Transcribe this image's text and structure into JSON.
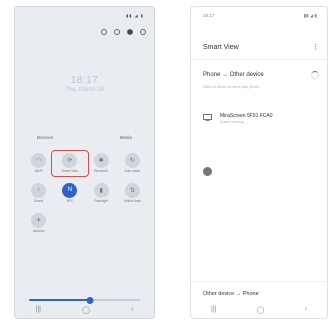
{
  "quick_panel": {
    "time": "18:17",
    "date": "Thu, March 19",
    "devices_label": "Devices",
    "media_label": "Media",
    "tiles": [
      {
        "label": "Wi-Fi",
        "icon": "wifi-icon",
        "glyph": "◠",
        "on": false
      },
      {
        "label": "Smart View",
        "icon": "smart-view-icon",
        "glyph": "⟳",
        "on": false,
        "highlighted": true
      },
      {
        "label": "Bluetooth",
        "icon": "bluetooth-icon",
        "glyph": "✱",
        "on": false
      },
      {
        "label": "Auto rotate",
        "icon": "rotate-icon",
        "glyph": "↻",
        "on": false
      },
      {
        "label": "Sound",
        "icon": "sound-icon",
        "glyph": "♪",
        "on": false
      },
      {
        "label": "NFC",
        "icon": "nfc-icon",
        "glyph": "N",
        "on": true
      },
      {
        "label": "Flashlight",
        "icon": "flashlight-icon",
        "glyph": "▮",
        "on": false
      },
      {
        "label": "Mobile data",
        "icon": "mobile-data-icon",
        "glyph": "⇅",
        "on": false
      },
      {
        "label": "Airplane",
        "icon": "airplane-icon",
        "glyph": "✈",
        "on": false
      }
    ],
    "brightness": 0.55,
    "nav": [
      "|||",
      "◯",
      "‹"
    ]
  },
  "smart_view": {
    "status_time": "18:17",
    "status_right": "▮▮ ◢ ▮",
    "title": "Smart View",
    "more": "⋮",
    "section_title": "Phone → Other device",
    "description": "Select a device to mirror your phone.",
    "device": {
      "name": "MiraScreen 5F91 FCA0",
      "sub": "Screen mirroring"
    },
    "footer": "Other device → Phone",
    "nav": [
      "|||",
      "◯",
      "‹"
    ]
  }
}
